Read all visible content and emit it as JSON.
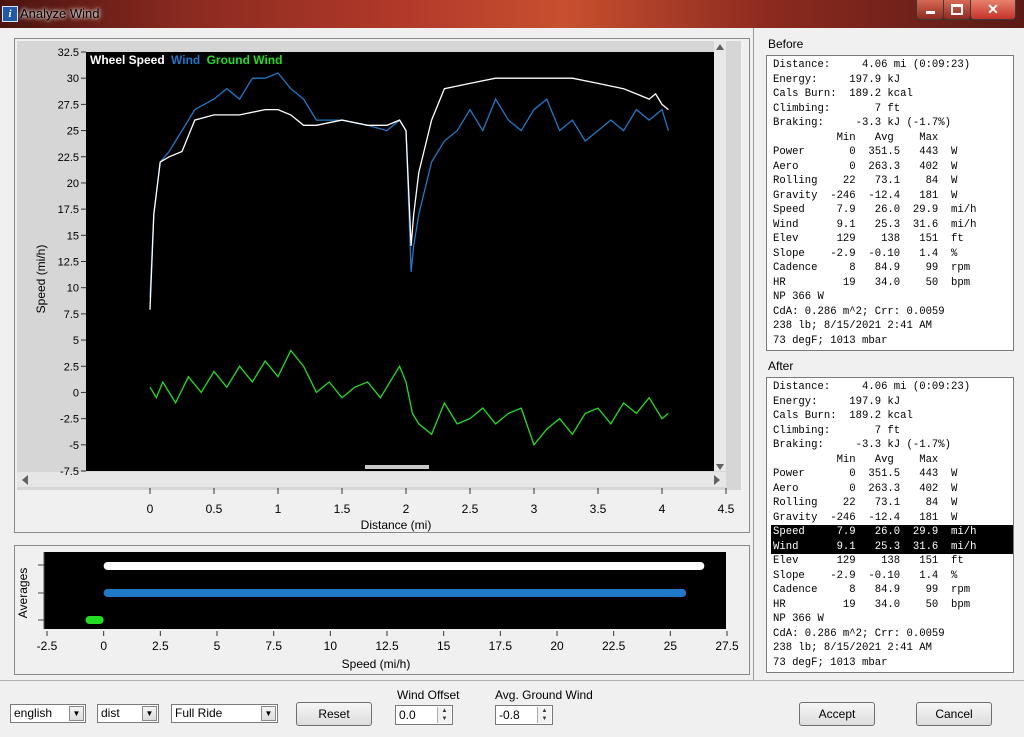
{
  "window": {
    "title": "Analyze Wind",
    "icon_label": "i",
    "close_glyph": "✕"
  },
  "main_chart": {
    "legend": [
      {
        "label": "Wheel Speed",
        "color": "#ffffff"
      },
      {
        "label": "Wind",
        "color": "#1f78c8"
      },
      {
        "label": "Ground Wind",
        "color": "#22dd22"
      }
    ],
    "xlabel": "Distance (mi)",
    "ylabel": "Speed (mi/h)",
    "xticks": [
      "0",
      "0.5",
      "1",
      "1.5",
      "2",
      "2.5",
      "3",
      "3.5",
      "4",
      "4.5"
    ],
    "yticks": [
      "32.5",
      "30",
      "27.5",
      "25",
      "22.5",
      "20",
      "17.5",
      "15",
      "12.5",
      "10",
      "7.5",
      "5",
      "2.5",
      "0",
      "-2.5",
      "-5",
      "-7.5"
    ]
  },
  "averages_chart": {
    "ylabel": "Averages",
    "xlabel": "Speed (mi/h)",
    "xticks": [
      "-2.5",
      "0",
      "2.5",
      "5",
      "7.5",
      "10",
      "12.5",
      "15",
      "17.5",
      "20",
      "22.5",
      "25",
      "27.5"
    ]
  },
  "chart_data": [
    {
      "type": "line",
      "xlabel": "Distance (mi)",
      "ylabel": "Speed (mi/h)",
      "xlim": [
        -0.5,
        4.5
      ],
      "ylim": [
        -7.5,
        32.5
      ],
      "legend_position": "top-left",
      "grid": false,
      "series": [
        {
          "name": "Wheel Speed",
          "color": "#ffffff",
          "x": [
            0,
            0.03,
            0.08,
            0.15,
            0.25,
            0.35,
            0.5,
            0.7,
            0.9,
            1.0,
            1.1,
            1.2,
            1.3,
            1.5,
            1.7,
            1.85,
            1.95,
            2.0,
            2.04,
            2.06,
            2.1,
            2.2,
            2.3,
            2.5,
            2.7,
            2.9,
            3.1,
            3.3,
            3.5,
            3.7,
            3.8,
            3.9,
            3.95,
            4.0,
            4.05
          ],
          "y": [
            7.9,
            17,
            22,
            22.5,
            23,
            26,
            26.5,
            26.5,
            27,
            27,
            26.5,
            25.5,
            25.5,
            26,
            25.5,
            25.5,
            26,
            25,
            14,
            17,
            21,
            26,
            29,
            29.5,
            30,
            30,
            30,
            30,
            29.5,
            29,
            28.5,
            28,
            28.5,
            27.5,
            27
          ]
        },
        {
          "name": "Wind",
          "color": "#1f78c8",
          "x": [
            0,
            0.03,
            0.08,
            0.15,
            0.25,
            0.35,
            0.5,
            0.6,
            0.7,
            0.8,
            0.9,
            1.0,
            1.1,
            1.2,
            1.3,
            1.5,
            1.7,
            1.85,
            1.95,
            2.0,
            2.04,
            2.06,
            2.1,
            2.2,
            2.3,
            2.4,
            2.5,
            2.6,
            2.7,
            2.8,
            2.9,
            3.0,
            3.1,
            3.2,
            3.3,
            3.4,
            3.5,
            3.6,
            3.7,
            3.8,
            3.9,
            4.0,
            4.05
          ],
          "y": [
            9.1,
            17,
            22,
            23,
            25,
            27,
            28,
            29,
            28,
            30,
            30,
            30.5,
            29,
            28,
            26,
            26,
            25.5,
            25,
            26,
            25,
            11.5,
            14,
            17,
            22,
            24,
            25,
            27,
            25,
            28,
            26,
            25,
            27,
            28,
            25,
            26,
            24,
            25,
            26,
            25,
            27,
            26,
            27,
            25
          ]
        },
        {
          "name": "Ground Wind",
          "color": "#22dd22",
          "x": [
            0,
            0.05,
            0.1,
            0.2,
            0.3,
            0.4,
            0.5,
            0.6,
            0.7,
            0.8,
            0.9,
            1.0,
            1.1,
            1.2,
            1.3,
            1.4,
            1.5,
            1.6,
            1.7,
            1.8,
            1.9,
            1.95,
            2.0,
            2.05,
            2.1,
            2.2,
            2.3,
            2.4,
            2.5,
            2.6,
            2.7,
            2.8,
            2.9,
            3.0,
            3.1,
            3.2,
            3.3,
            3.4,
            3.5,
            3.6,
            3.7,
            3.8,
            3.9,
            4.0,
            4.05
          ],
          "y": [
            0.5,
            -0.5,
            1,
            -1,
            1.5,
            0,
            2,
            0.5,
            2.5,
            1,
            3,
            1.5,
            4,
            2.5,
            0,
            1,
            -0.5,
            0.5,
            1,
            -0.5,
            1.5,
            2.5,
            1,
            -2,
            -3,
            -4,
            -1,
            -3,
            -2.5,
            -1.5,
            -3,
            -2,
            -1.5,
            -5,
            -3.5,
            -2.5,
            -4,
            -2,
            -1.5,
            -3,
            -1,
            -2,
            -0.5,
            -2.5,
            -2
          ]
        }
      ]
    },
    {
      "type": "bar",
      "orientation": "horizontal",
      "xlabel": "Speed (mi/h)",
      "ylabel": "Averages",
      "xlim": [
        -2.5,
        27.5
      ],
      "categories": [
        "Wheel Speed",
        "Wind",
        "Ground Wind"
      ],
      "values": [
        26.5,
        25.7,
        -0.8
      ],
      "colors": [
        "#ffffff",
        "#1f78c8",
        "#22dd22"
      ]
    }
  ],
  "before": {
    "label": "Before",
    "lines": [
      "Distance:     4.06 mi (0:09:23)",
      "Energy:     197.9 kJ",
      "Cals Burn:  189.2 kcal",
      "Climbing:       7 ft",
      "Braking:     -3.3 kJ (-1.7%)",
      "          Min   Avg    Max",
      "Power       0  351.5   443  W",
      "Aero        0  263.3   402  W",
      "Rolling    22   73.1    84  W",
      "Gravity  -246  -12.4   181  W",
      "Speed     7.9   26.0  29.9  mi/h",
      "Wind      9.1   25.3  31.6  mi/h",
      "Elev      129    138   151  ft",
      "Slope    -2.9  -0.10   1.4  %",
      "Cadence     8   84.9    99  rpm",
      "HR         19   34.0    50  bpm",
      "NP 366 W",
      "CdA: 0.286 m^2; Crr: 0.0059",
      "238 lb; 8/15/2021 2:41 AM",
      "73 degF; 1013 mbar"
    ]
  },
  "after": {
    "label": "After",
    "highlighted_rows": [
      10,
      11
    ],
    "lines": [
      "Distance:     4.06 mi (0:09:23)",
      "Energy:     197.9 kJ",
      "Cals Burn:  189.2 kcal",
      "Climbing:       7 ft",
      "Braking:     -3.3 kJ (-1.7%)",
      "          Min   Avg    Max",
      "Power       0  351.5   443  W",
      "Aero        0  263.3   402  W",
      "Rolling    22   73.1    84  W",
      "Gravity  -246  -12.4   181  W",
      "Speed     7.9   26.0  29.9  mi/h",
      "Wind      9.1   25.3  31.6  mi/h",
      "Elev      129    138   151  ft",
      "Slope    -2.9  -0.10   1.4  %",
      "Cadence     8   84.9    99  rpm",
      "HR         19   34.0    50  bpm",
      "NP 366 W",
      "CdA: 0.286 m^2; Crr: 0.0059",
      "238 lb; 8/15/2021 2:41 AM",
      "73 degF; 1013 mbar"
    ]
  },
  "controls": {
    "units_select": "english",
    "xaxis_select": "dist",
    "range_select": "Full Ride",
    "reset_label": "Reset",
    "wind_offset_label": "Wind Offset",
    "wind_offset_value": "0.0",
    "ground_wind_label": "Avg. Ground Wind",
    "ground_wind_value": "-0.8",
    "accept_label": "Accept",
    "cancel_label": "Cancel",
    "dropdown_arrow": "▼",
    "spin_up": "▲",
    "spin_down": "▼"
  }
}
